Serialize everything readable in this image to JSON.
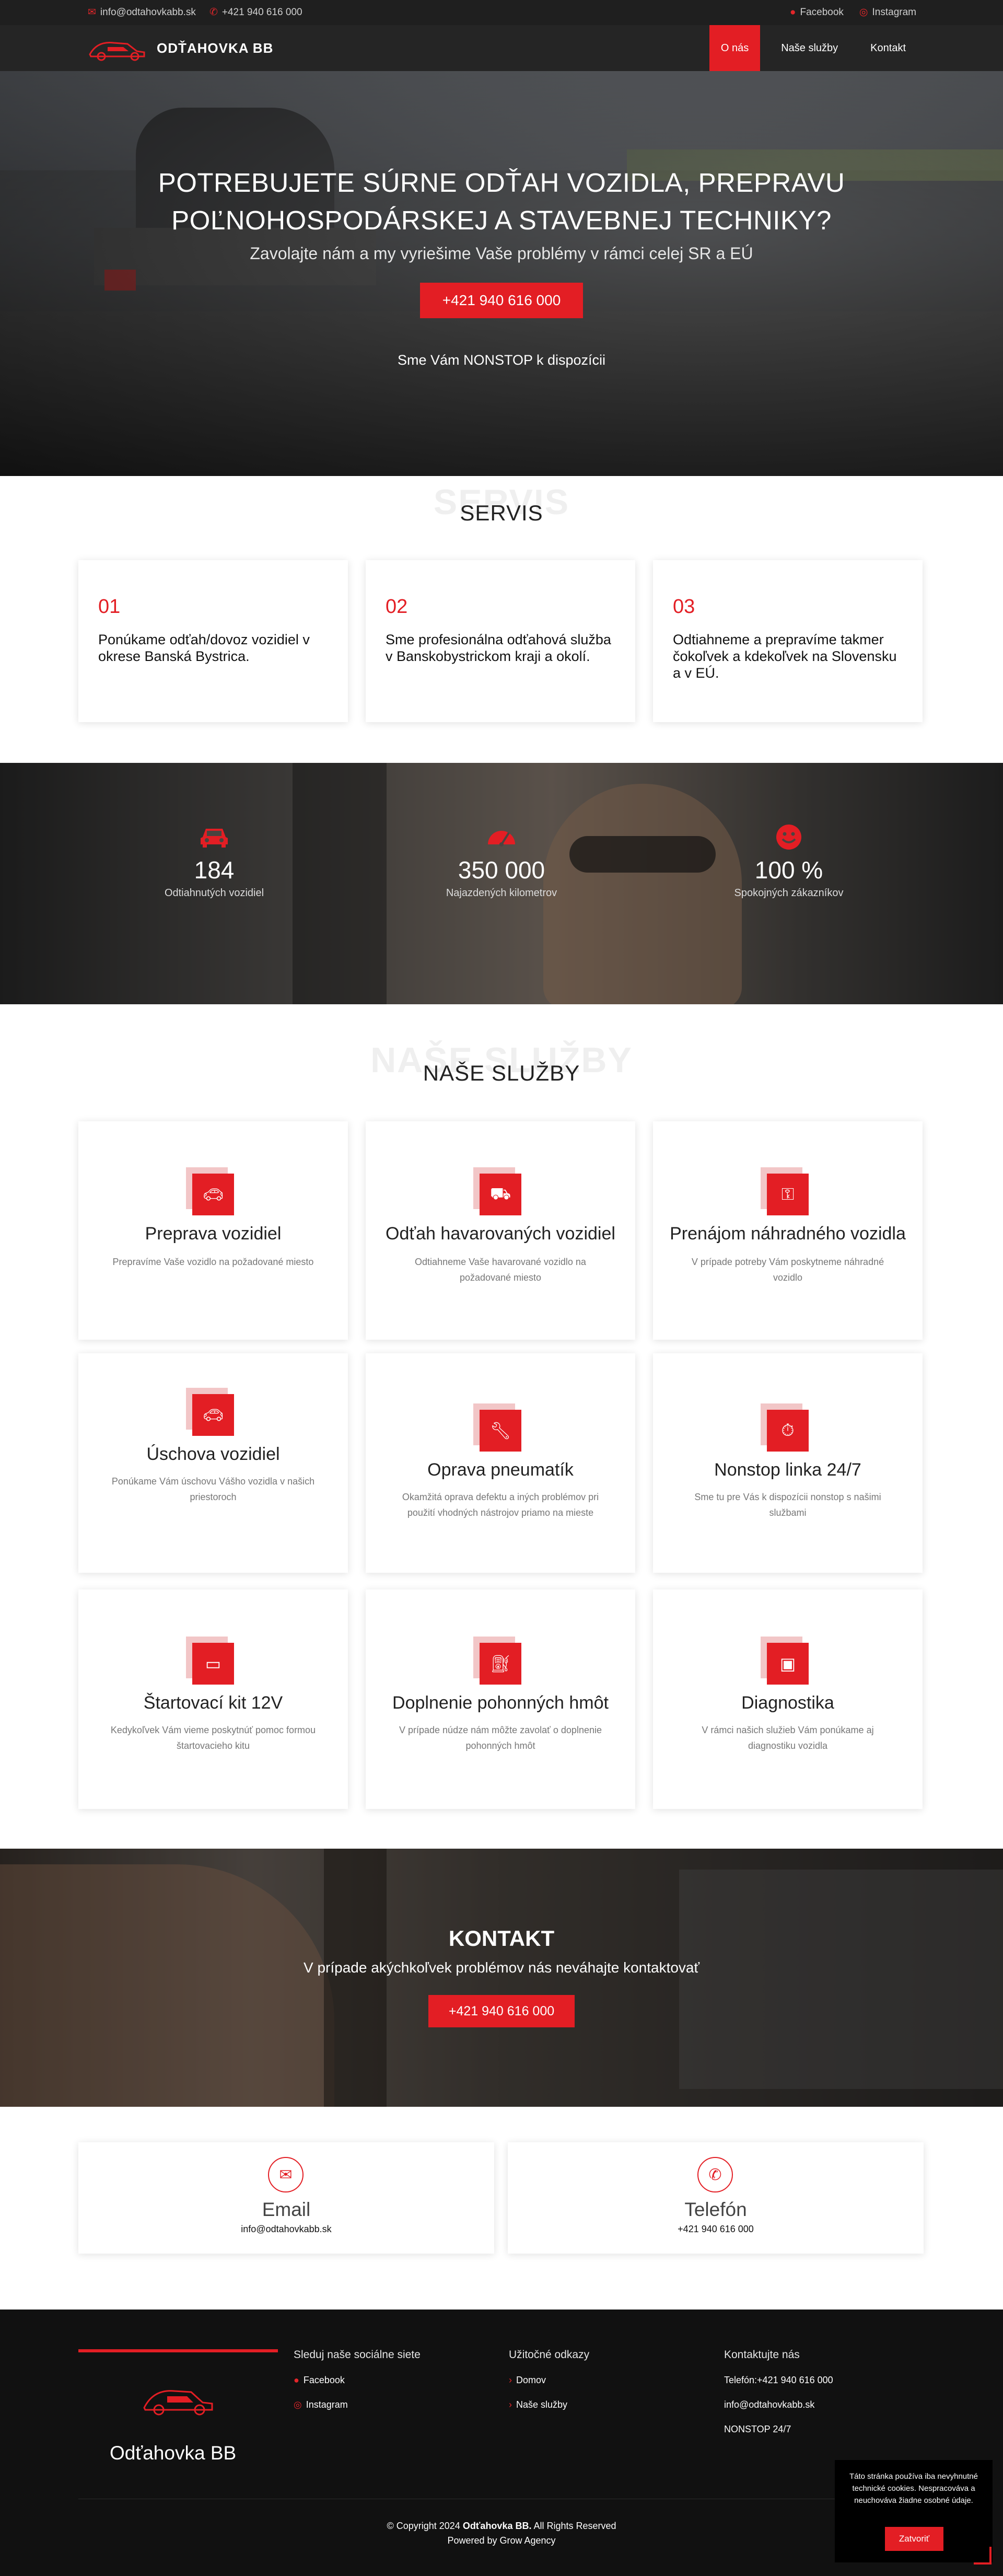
{
  "topbar": {
    "email": "info@odtahovkabb.sk",
    "phone": "+421 940 616 000",
    "facebook": "Facebook",
    "instagram": "Instagram"
  },
  "nav": {
    "brand": "ODŤAHOVKA BB",
    "items": [
      "O nás",
      "Naše služby",
      "Kontakt"
    ]
  },
  "hero": {
    "title_line1": "POTREBUJETE SÚRNE ODŤAH VOZIDLA, PREPRAVU",
    "title_line2": "POĽNOHOSPODÁRSKEJ A STAVEBNEJ TECHNIKY?",
    "subtitle": "Zavolajte nám a my vyriešime Vaše problémy v rámci celej SR a EÚ",
    "cta": "+421 940 616 000",
    "nonstop": "Sme Vám NONSTOP k dispozícii"
  },
  "servis": {
    "ghost": "SERVIS",
    "title": "SERVIS",
    "cards": [
      {
        "num": "01",
        "text": "Ponúkame odťah/dovoz vozidiel v okrese Banská Bystrica."
      },
      {
        "num": "02",
        "text": "Sme profesionálna odťahová služba v Banskobystrickom kraji a okolí."
      },
      {
        "num": "03",
        "text": "Odtiahneme a prepravíme takmer čokoľvek a kdekoľvek na Slovensku a v EÚ."
      }
    ]
  },
  "stats": [
    {
      "icon": "car-icon",
      "value": "184",
      "label": "Odtiahnutých vozidiel"
    },
    {
      "icon": "speedometer-icon",
      "value": "350 000",
      "label": "Najazdených kilometrov"
    },
    {
      "icon": "smile-icon",
      "value": "100 %",
      "label": "Spokojných zákazníkov"
    }
  ],
  "sluzby": {
    "ghost": "NAŠE SLUŽBY",
    "title": "NAŠE SLUŽBY",
    "items": [
      {
        "icon": "car-icon",
        "title": "Preprava vozidiel",
        "desc": "Prepravíme Vaše vozidlo na požadované miesto"
      },
      {
        "icon": "tow-truck-icon",
        "title": "Odťah havarovaných vozidiel",
        "desc": "Odtiahneme Vaše havarované vozidlo na požadované miesto"
      },
      {
        "icon": "key-icon",
        "title": "Prenájom náhradného vozidla",
        "desc": "V prípade potreby Vám poskytneme náhradné vozidlo"
      },
      {
        "icon": "car-icon",
        "title": "Úschova vozidiel",
        "desc": "Ponúkame Vám úschovu Vášho vozidla v našich priestoroch"
      },
      {
        "icon": "wrench-icon",
        "title": "Oprava pneumatík",
        "desc": "Okamžitá oprava defektu a iných problémov pri použití vhodných nástrojov priamo na mieste"
      },
      {
        "icon": "stopwatch-icon",
        "title": "Nonstop linka 24/7",
        "desc": "Sme tu pre Vás k dispozícii nonstop s našimi službami"
      },
      {
        "icon": "battery-icon",
        "title": "Štartovací kit 12V",
        "desc": "Kedykoľvek Vám vieme poskytnúť pomoc formou štartovacieho kitu"
      },
      {
        "icon": "fuel-icon",
        "title": "Doplnenie pohonných hmôt",
        "desc": "V prípade núdze nám môžte zavolať o doplnenie pohonných hmôt"
      },
      {
        "icon": "laptop-icon",
        "title": "Diagnostika",
        "desc": "V rámci našich služieb Vám ponúkame aj diagnostiku vozidla"
      }
    ]
  },
  "kontakt": {
    "title": "KONTAKT",
    "subtitle": "V prípade akýchkoľvek problémov nás neváhajte kontaktovať",
    "cta": "+421 940 616 000"
  },
  "contact_cards": [
    {
      "icon": "envelope-icon",
      "title": "Email",
      "value": "info@odtahovkabb.sk"
    },
    {
      "icon": "phone-icon",
      "title": "Telefón",
      "value": "+421 940 616 000"
    }
  ],
  "footer": {
    "name": "Odťahovka BB",
    "social_title": "Sleduj naše sociálne siete",
    "social": [
      "Facebook",
      "Instagram"
    ],
    "links_title": "Užitočné odkazy",
    "links": [
      "Domov",
      "Naše služby"
    ],
    "contact_title": "Kontaktujte nás",
    "contact": [
      "Telefón:+421 940 616 000",
      "info@odtahovkabb.sk",
      "NONSTOP 24/7"
    ],
    "copy_pre": "© Copyright 2024 ",
    "copy_brand": "Odťahovka BB.",
    "copy_post": " All Rights Reserved",
    "powered": "Powered by Grow Agency"
  },
  "cookie": {
    "text": "Táto stránka používa iba nevyhnutné technické cookies. Nespracováva a neuchováva žiadne osobné údaje.",
    "button": "Zatvoriť"
  },
  "colors": {
    "accent": "#e31e24",
    "dark": "#1f1f1f",
    "footer": "#111111"
  }
}
